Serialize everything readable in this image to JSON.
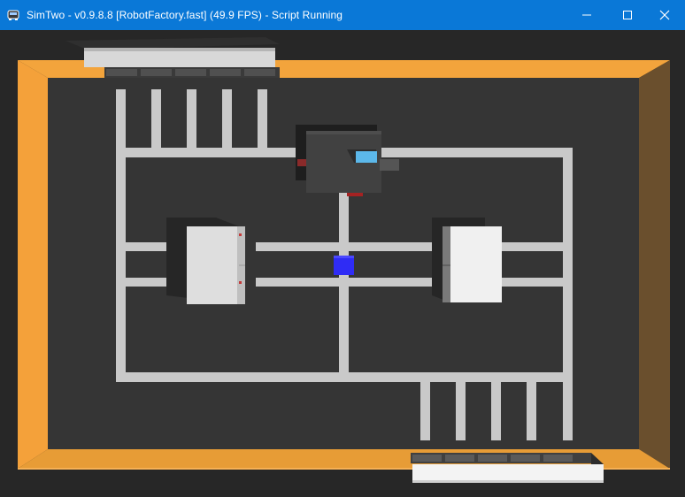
{
  "window": {
    "title": "SimTwo - v0.9.8.8 [RobotFactory.fast] (49.9 FPS) - Script Running",
    "app_icon": "robot-icon",
    "controls": {
      "minimize_icon": "minimize-icon",
      "maximize_icon": "maximize-icon",
      "close_icon": "close-icon"
    }
  },
  "colors": {
    "titlebar": "#0a78d7",
    "floor": "#353535",
    "background": "#272727",
    "wall_orange": "#f2a33a",
    "track_line": "#cfcfcf",
    "machine_white": "#ececec",
    "robot_dark": "#3c3c3c",
    "robot_accent": "#5cb8ea",
    "part_blue": "#2f2cf5",
    "wheel_red": "#a32020"
  },
  "scene": {
    "objects": [
      "arena-wall",
      "input-warehouse",
      "output-warehouse",
      "machine-left",
      "machine-right",
      "robot",
      "part-box"
    ]
  }
}
